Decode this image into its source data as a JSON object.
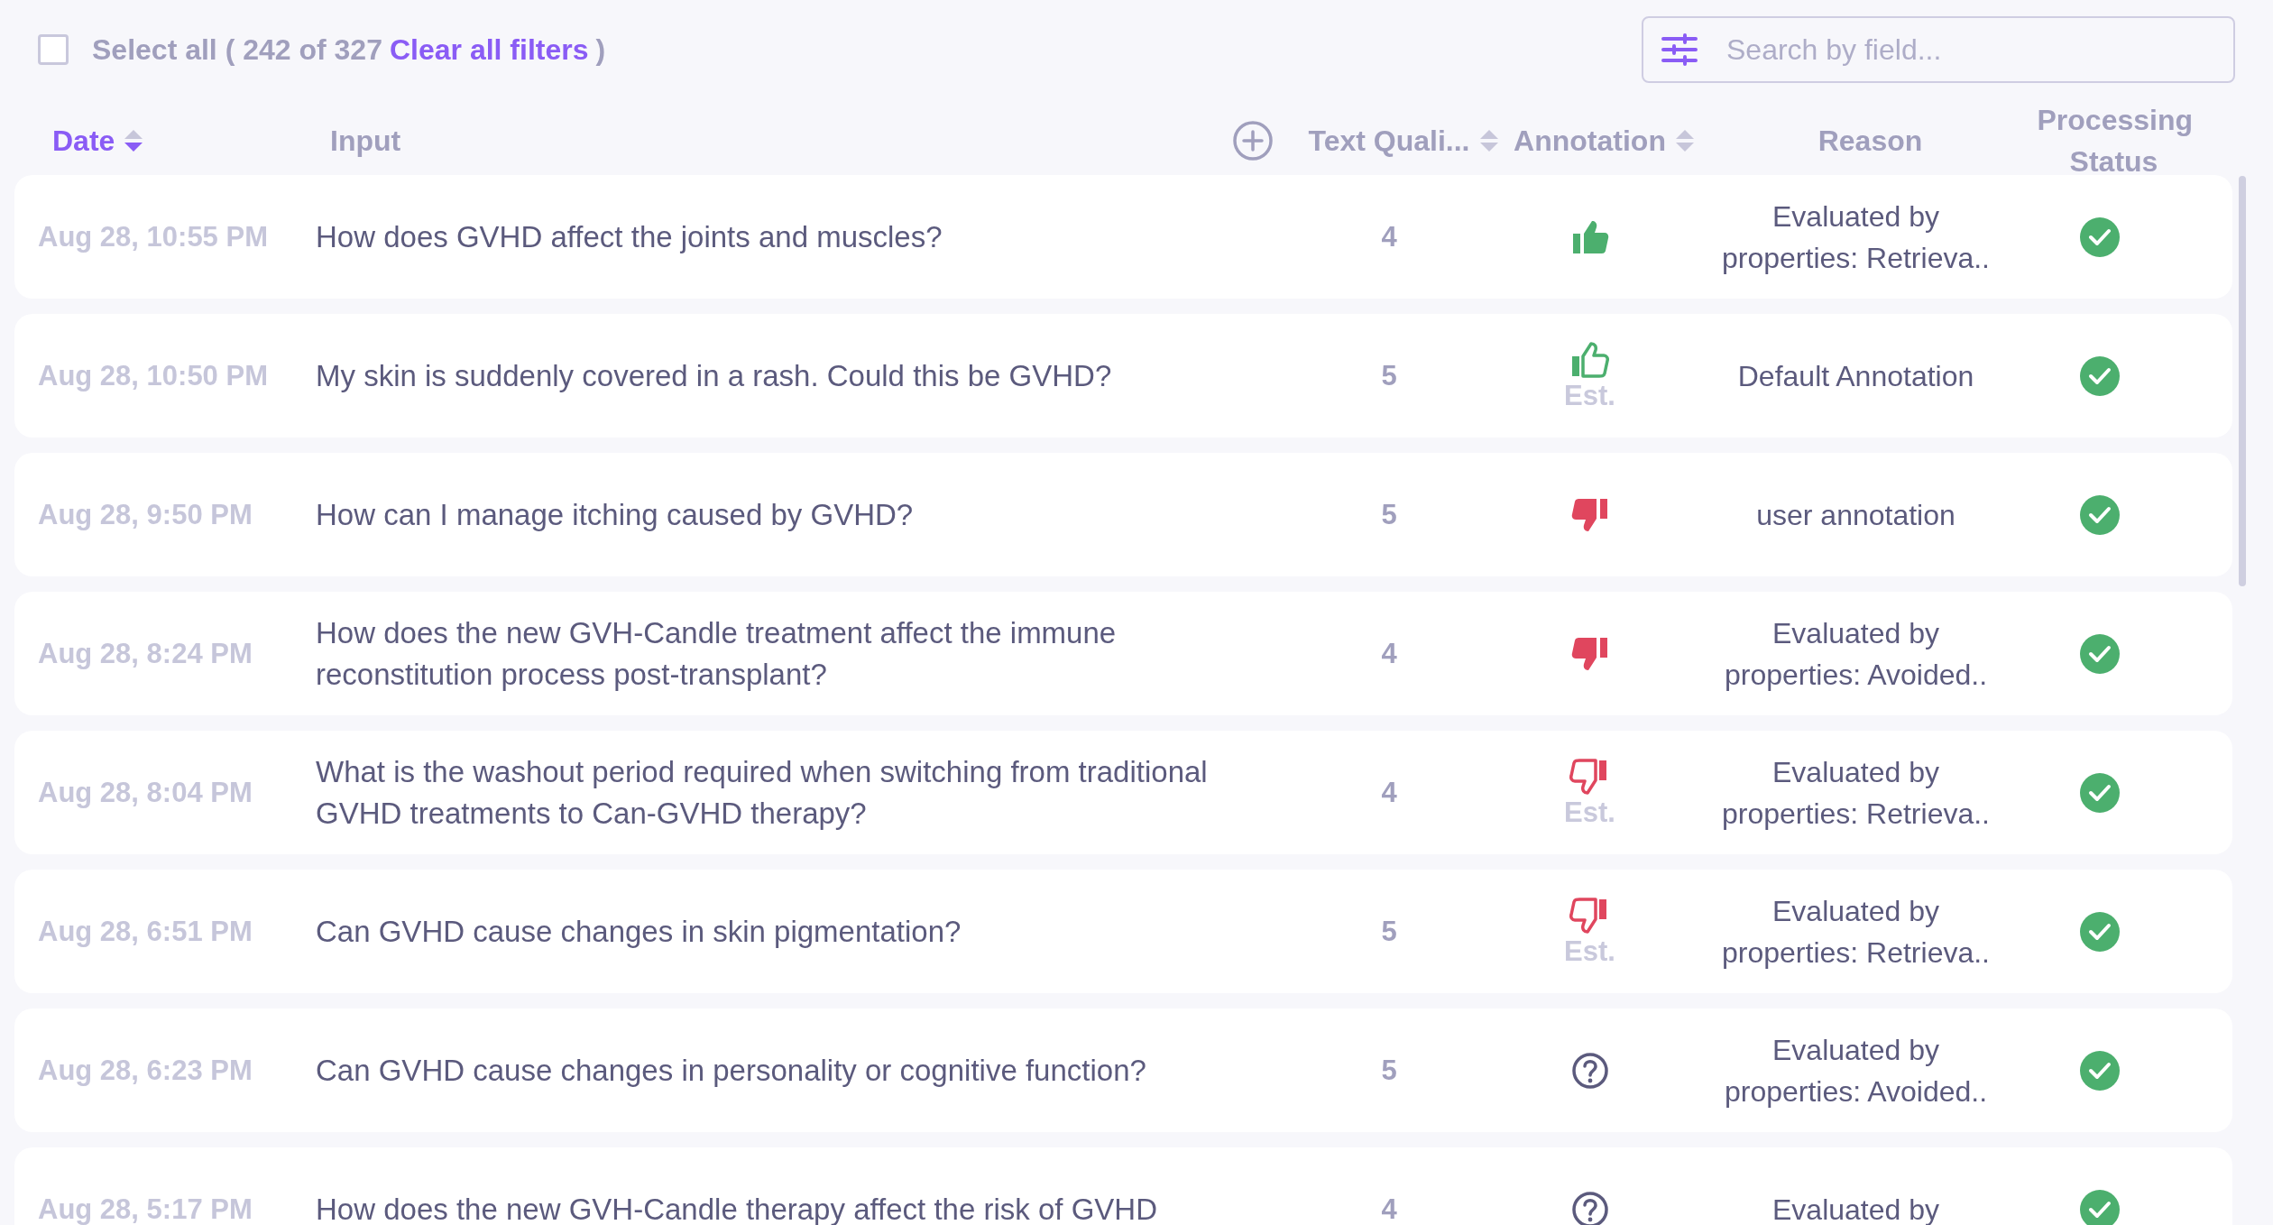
{
  "toolbar": {
    "select_all": {
      "checked": false,
      "label": "Select all",
      "count_text": "( 242 of 327",
      "link": "Clear all filters",
      "close": ")"
    },
    "search": {
      "placeholder": "Search by field..."
    }
  },
  "columns": [
    {
      "kind": "sort",
      "label": "Date",
      "selected": true
    },
    {
      "kind": "plain",
      "label": "Input",
      "selected": false
    },
    {
      "kind": "sort",
      "label": "Text Quali...",
      "selected": false
    },
    {
      "kind": "sort",
      "label": "Annotation",
      "selected": false
    },
    {
      "kind": "plain",
      "label": "Reason",
      "selected": false
    },
    {
      "kind": "plain",
      "label": "Processing Status",
      "selected": false
    }
  ],
  "rows": [
    {
      "date": "Aug 28, 10:55 PM",
      "input": "How does GVHD affect the joints and muscles?",
      "quality": "4",
      "annotation": {
        "kind": "up",
        "filled": true
      },
      "reason": "Evaluated by properties: Retrieva..",
      "done": true
    },
    {
      "date": "Aug 28, 10:50 PM",
      "input": "My skin is suddenly covered in a rash. Could this be GVHD?",
      "quality": "5",
      "annotation": {
        "kind": "up",
        "filled": false,
        "note": "Est."
      },
      "reason": "Default Annotation",
      "done": true
    },
    {
      "date": "Aug 28, 9:50 PM",
      "input": "How can I manage itching caused by GVHD?",
      "quality": "5",
      "annotation": {
        "kind": "down",
        "filled": true
      },
      "reason": "user annotation",
      "done": true
    },
    {
      "date": "Aug 28, 8:24 PM",
      "input": "How does the new GVH-Candle treatment affect the immune reconstitution process post-transplant?",
      "quality": "4",
      "annotation": {
        "kind": "down",
        "filled": true
      },
      "reason": "Evaluated by properties: Avoided..",
      "done": true
    },
    {
      "date": "Aug 28, 8:04 PM",
      "input": "What is the washout period required when switching from traditional GVHD treatments to Can-GVHD therapy?",
      "quality": "4",
      "annotation": {
        "kind": "down",
        "filled": false,
        "note": "Est."
      },
      "reason": "Evaluated by properties: Retrieva..",
      "done": true
    },
    {
      "date": "Aug 28, 6:51 PM",
      "input": "Can GVHD cause changes in skin pigmentation?",
      "quality": "5",
      "annotation": {
        "kind": "down",
        "filled": false,
        "note": "Est."
      },
      "reason": "Evaluated by properties: Retrieva..",
      "done": true
    },
    {
      "date": "Aug 28, 6:23 PM",
      "input": "Can GVHD cause changes in personality or cognitive function?",
      "quality": "5",
      "annotation": {
        "kind": "unknown",
        "filled": false
      },
      "reason": "Evaluated by properties: Avoided..",
      "done": true
    },
    {
      "date": "Aug 28, 5:17 PM",
      "input": "How does the new GVH-Candle therapy affect the risk of GVHD",
      "quality": "4",
      "annotation": {
        "kind": "unknown",
        "filled": false
      },
      "reason": "Evaluated by",
      "done": true
    }
  ]
}
